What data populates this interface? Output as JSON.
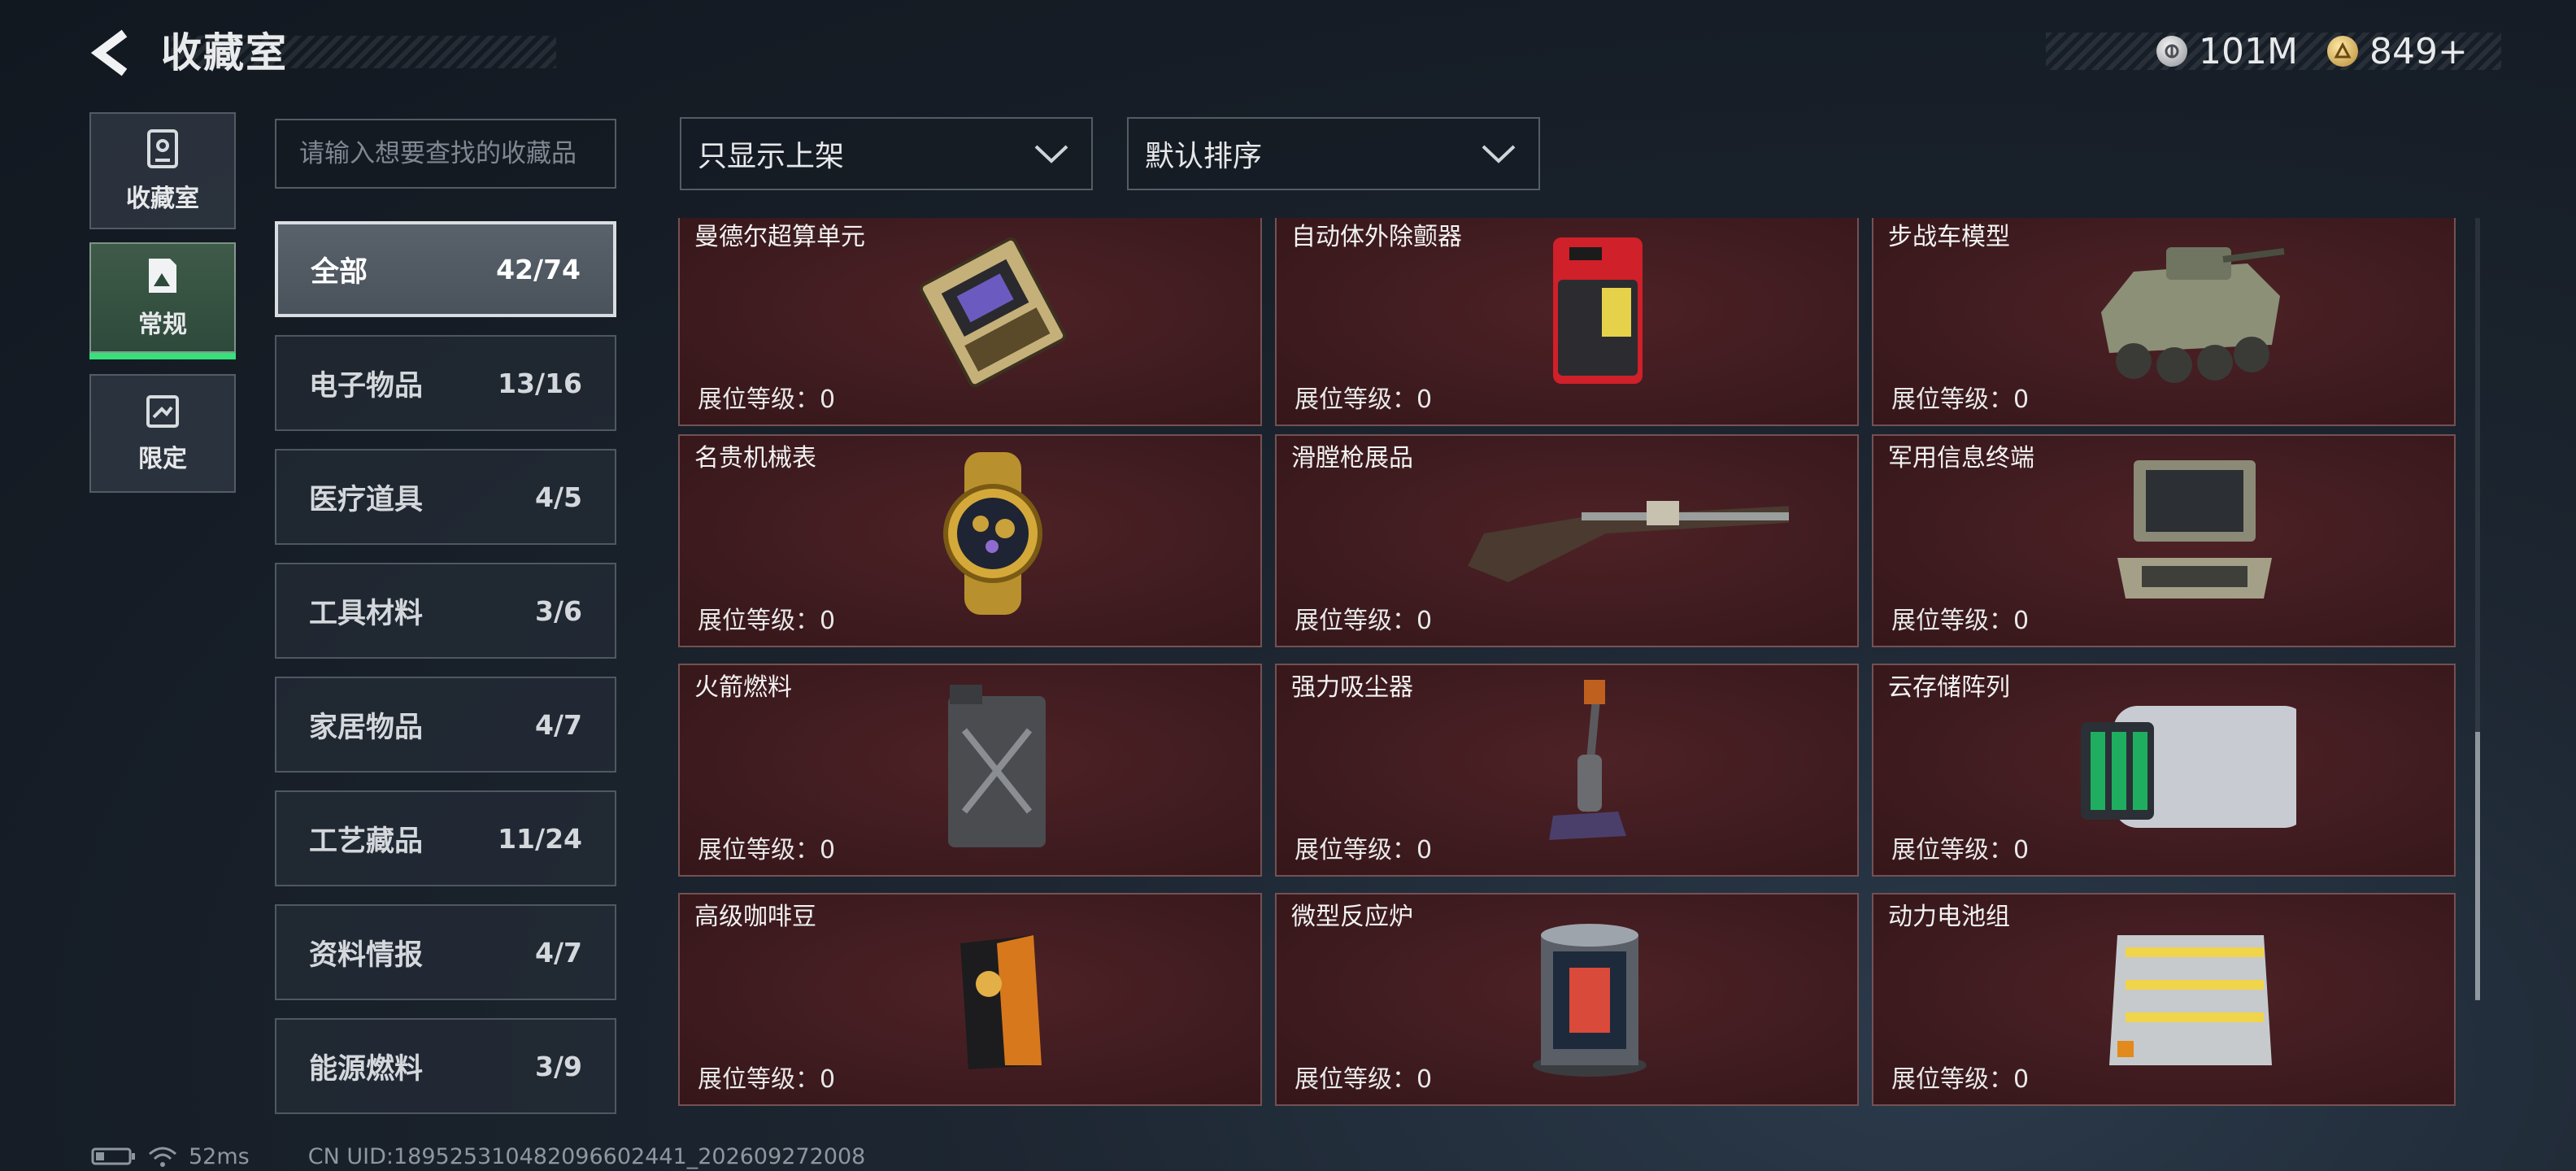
{
  "header": {
    "title": "收藏室"
  },
  "currency": [
    {
      "icon": "silver-coin-icon",
      "value": "101M"
    },
    {
      "icon": "gold-coin-icon",
      "value": "849+"
    }
  ],
  "rail": [
    {
      "label": "收藏室",
      "icon": "collection-room-icon",
      "active": false
    },
    {
      "label": "常规",
      "icon": "regular-icon",
      "active": true
    },
    {
      "label": "限定",
      "icon": "limited-icon",
      "active": false
    }
  ],
  "search": {
    "placeholder": "请输入想要查找的收藏品",
    "value": ""
  },
  "filters": {
    "display_value": "只显示上架",
    "sort_value": "默认排序"
  },
  "categories": [
    {
      "name": "全部",
      "count": "42/74",
      "active": true
    },
    {
      "name": "电子物品",
      "count": "13/16"
    },
    {
      "name": "医疗道具",
      "count": "4/5"
    },
    {
      "name": "工具材料",
      "count": "3/6"
    },
    {
      "name": "家居物品",
      "count": "4/7"
    },
    {
      "name": "工艺藏品",
      "count": "11/24"
    },
    {
      "name": "资料情报",
      "count": "4/7"
    },
    {
      "name": "能源燃料",
      "count": "3/9"
    }
  ],
  "items": [
    {
      "name": "曼德尔超算单元",
      "level": "展位等级：0",
      "icon": "supercomputer-unit-icon"
    },
    {
      "name": "自动体外除颤器",
      "level": "展位等级：0",
      "icon": "defibrillator-icon"
    },
    {
      "name": "步战车模型",
      "level": "展位等级：0",
      "icon": "armored-vehicle-model-icon"
    },
    {
      "name": "名贵机械表",
      "level": "展位等级：0",
      "icon": "luxury-watch-icon"
    },
    {
      "name": "滑膛枪展品",
      "level": "展位等级：0",
      "icon": "musket-icon"
    },
    {
      "name": "军用信息终端",
      "level": "展位等级：0",
      "icon": "military-terminal-icon"
    },
    {
      "name": "火箭燃料",
      "level": "展位等级：0",
      "icon": "rocket-fuel-can-icon"
    },
    {
      "name": "强力吸尘器",
      "level": "展位等级：0",
      "icon": "vacuum-cleaner-icon"
    },
    {
      "name": "云存储阵列",
      "level": "展位等级：0",
      "icon": "cloud-storage-array-icon"
    },
    {
      "name": "高级咖啡豆",
      "level": "展位等级：0",
      "icon": "coffee-bag-icon"
    },
    {
      "name": "微型反应炉",
      "level": "展位等级：0",
      "icon": "micro-reactor-icon"
    },
    {
      "name": "动力电池组",
      "level": "展位等级：0",
      "icon": "battery-pack-icon"
    }
  ],
  "status": {
    "ping": "52ms",
    "uid": "CN UID:18952531048209660244​1_202609272008"
  }
}
